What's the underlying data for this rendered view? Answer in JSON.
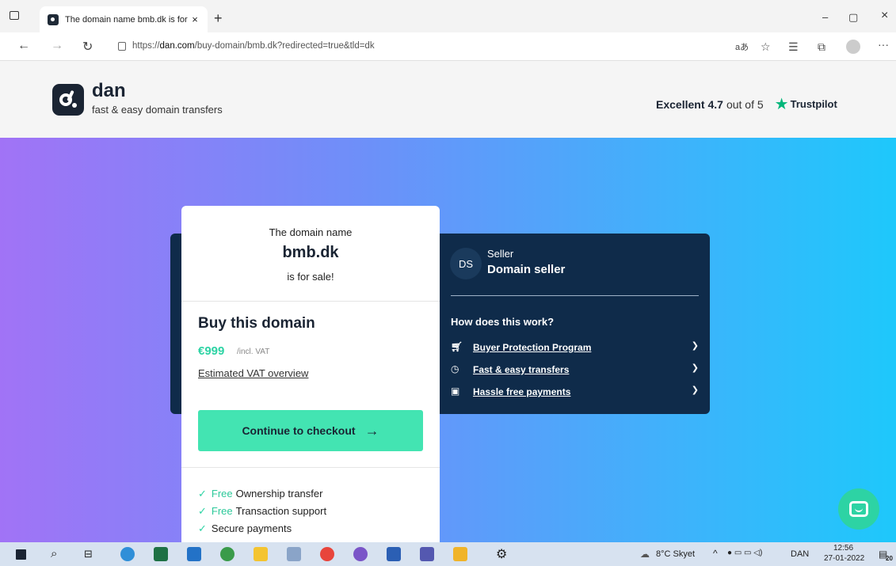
{
  "browser": {
    "tab_title": "The domain name bmb.dk is for",
    "tab_close": "×",
    "new_tab": "+",
    "url_prefix": "https://",
    "url_host": "dan.com",
    "url_path": "/buy-domain/bmb.dk?redirected=true&tld=dk",
    "window_min": "–",
    "window_restore": "▢",
    "window_close": "×",
    "more_menu": "···"
  },
  "header": {
    "brand": "dan",
    "tagline": "fast & easy domain transfers",
    "trust_excellent": "Excellent",
    "trust_score": "4.7",
    "trust_of": "out of 5",
    "trust_brand": "Trustpilot",
    "trust_color": "#00b67a"
  },
  "listing": {
    "intro": "The domain name",
    "domain": "bmb.dk",
    "for_sale": "is for sale!",
    "buy_title": "Buy this domain",
    "price": "€999",
    "vat_note": "/incl. VAT",
    "vat_link": "Estimated VAT overview",
    "checkout_label": "Continue to checkout",
    "features": [
      {
        "free": "Free",
        "text": "Ownership transfer"
      },
      {
        "free": "Free",
        "text": "Transaction support"
      },
      {
        "free": "",
        "text": "Secure payments"
      }
    ]
  },
  "seller": {
    "initials": "DS",
    "label": "Seller",
    "name": "Domain seller"
  },
  "how": {
    "title": "How does this work?",
    "items": [
      {
        "label": "Buyer Protection Program",
        "icon": "cart-icon"
      },
      {
        "label": "Fast & easy transfers",
        "icon": "clock-icon"
      },
      {
        "label": "Hassle free payments",
        "icon": "payment-icon"
      }
    ]
  },
  "taskbar": {
    "weather": "8°C Skyet",
    "language": "DAN",
    "time": "12:56",
    "date": "27-01-2022",
    "notifications": "20"
  },
  "colors": {
    "accent_green": "#43e4b2",
    "dark_navy": "#0f2b4a",
    "gradient_start": "#a173f6",
    "gradient_end": "#1ec8fb"
  }
}
